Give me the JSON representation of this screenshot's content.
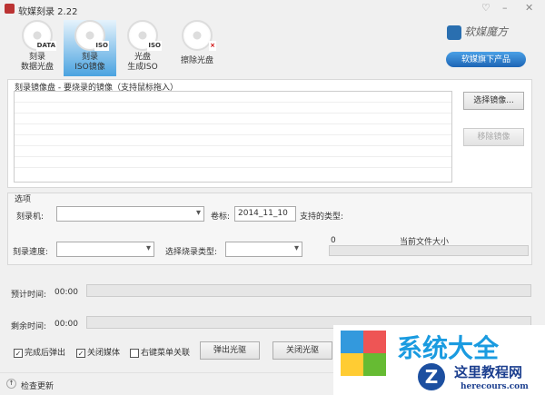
{
  "window": {
    "title": "软媒刻录 2.22"
  },
  "toolbar": [
    {
      "label1": "刻录",
      "label2": "数据光盘",
      "badge": "DATA"
    },
    {
      "label1": "刻录",
      "label2": "ISO镜像",
      "badge": "ISO"
    },
    {
      "label1": "光盘",
      "label2": "生成ISO",
      "badge": "ISO"
    },
    {
      "label1": "擦除光盘",
      "label2": "",
      "badge": "×"
    }
  ],
  "brand": {
    "name": "软媒魔方",
    "products_button": "软媒旗下产品"
  },
  "image_group": {
    "title": "刻录镜像盘 - 要烧录的镜像（支持鼠标拖入）",
    "select_button": "选择镜像...",
    "remove_button": "移除镜像"
  },
  "options": {
    "title": "选项",
    "burner_label": "刻录机:",
    "volume_label": "卷标:",
    "volume_value": "2014_11_10",
    "supported_label": "支持的类型:",
    "speed_label": "刻录速度:",
    "burn_type_label": "选择烧录类型:",
    "size_value": "0",
    "size_label": "当前文件大小"
  },
  "progress": {
    "estimated_label": "预计时间:",
    "estimated_value": "00:00",
    "remaining_label": "剩余时间:",
    "remaining_value": "00:00"
  },
  "checks": {
    "eject": "完成后弹出",
    "eject_checked": true,
    "close_media": "关闭媒体",
    "close_checked": true,
    "context_menu": "右键菜单关联",
    "context_checked": false
  },
  "buttons": {
    "eject": "弹出光驱",
    "close": "关闭光驱"
  },
  "footer": {
    "update": "检查更新"
  },
  "watermark": {
    "text1": "系统大全",
    "text2": "这里教程网",
    "text3": "herecours.com"
  }
}
